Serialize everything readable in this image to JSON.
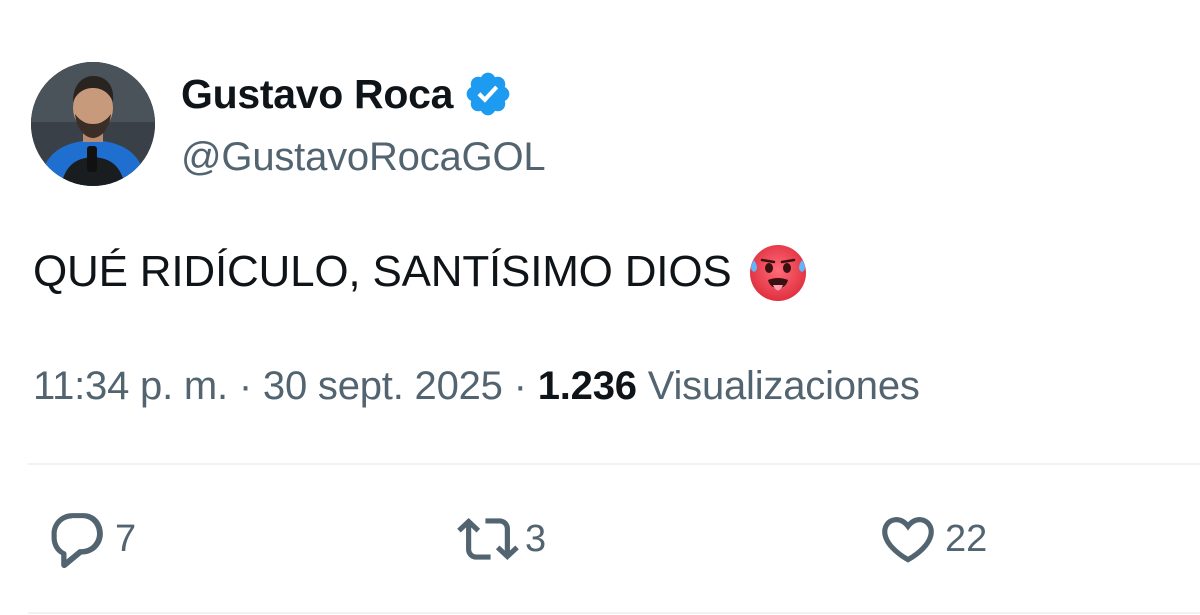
{
  "author": {
    "display_name": "Gustavo Roca",
    "handle": "@GustavoRocaGOL",
    "verified": true,
    "verified_color": "#1d9bf0"
  },
  "tweet": {
    "text": "QUÉ RIDÍCULO, SANTÍSIMO DIOS",
    "emoji": "hot-face-emoji"
  },
  "meta": {
    "time": "11:34 p. m.",
    "separator": " · ",
    "date": "30 sept. 2025",
    "views_count": "1.236",
    "views_label": " Visualizaciones"
  },
  "actions": {
    "replies": "7",
    "retweets": "3",
    "likes": "22"
  },
  "colors": {
    "text_primary": "#0f1419",
    "text_secondary": "#536471",
    "divider": "#eff3f4"
  }
}
